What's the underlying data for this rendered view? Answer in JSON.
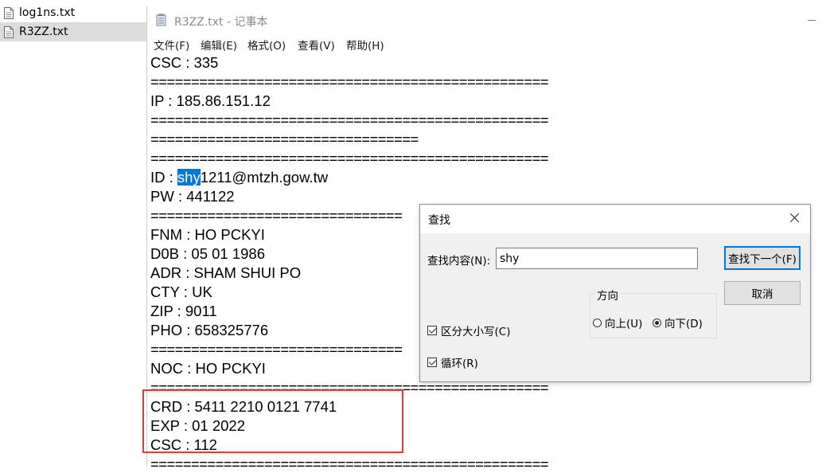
{
  "explorer": {
    "files": [
      "log1ns.txt",
      "R3ZZ.txt"
    ]
  },
  "notepad": {
    "title": "R3ZZ.txt - 记事本",
    "menu": [
      "文件(F)",
      "编辑(E)",
      "格式(O)",
      "查看(V)",
      "帮助(H)"
    ],
    "lines": {
      "csc1": "CSC : 335",
      "sep_full": "=================================================",
      "ip": "IP : 185.86.151.12",
      "sep_short": "=================================",
      "id_selected": "shy",
      "id_prefix": "ID : ",
      "id_rest": "1211@mtzh.gow.tw",
      "pw": "PW : 441122",
      "sep_partial": "===============================",
      "fnm": "FNM : HO PCKYI",
      "dob": "D0B : 05 01 1986",
      "adr": "ADR : SHAM SHUI PO",
      "cty": "CTY : UK",
      "zip": "ZIP : 9011",
      "pho": "PHO : 658325776",
      "noc": "NOC : HO PCKYI",
      "crd": "CRD : 5411 2210 0121 7741",
      "exp": "EXP : 01 2022",
      "csc2": "CSC : 112"
    }
  },
  "find_dialog": {
    "title": "查找",
    "find_label": "查找内容(N):",
    "find_value": "shy",
    "find_next": "查找下一个(F)",
    "cancel": "取消",
    "direction_label": "方向",
    "up_label": "向上(U)",
    "down_label": "向下(D)",
    "direction_selected": "down",
    "match_case_label": "区分大小写(C)",
    "match_case_checked": true,
    "wrap_label": "循环(R)",
    "wrap_checked": true
  },
  "colors": {
    "selection": "#0078d7",
    "highlight_box": "#e03c3c"
  }
}
